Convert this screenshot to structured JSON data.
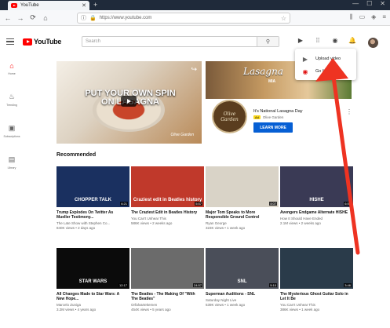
{
  "browser": {
    "tab_title": "YouTube",
    "tab_close": "✕",
    "new_tab": "+",
    "window_controls": [
      "—",
      "☐",
      "✕"
    ],
    "url": "https://www.youtube.com"
  },
  "header": {
    "logo_text": "YouTube",
    "search_placeholder": "Search"
  },
  "sidebar": {
    "items": [
      {
        "label": "Home",
        "icon": "home-icon"
      },
      {
        "label": "Trending",
        "icon": "flame-icon"
      },
      {
        "label": "Subscriptions",
        "icon": "subscriptions-icon"
      },
      {
        "label": "Library",
        "icon": "library-icon"
      }
    ]
  },
  "hero": {
    "caption": "PUT YOUR OWN SPIN ON LASAGNA",
    "brand": "Olive Garden"
  },
  "ad": {
    "banner_word": "Lasagna",
    "banner_sub": "MIA",
    "logo_line1": "Olive",
    "logo_line2": "Garden",
    "title": "It's National Lasagna Day",
    "badge": "Ad",
    "channel": "Olive Garden",
    "button": "LEARN MORE"
  },
  "dropdown": {
    "items": [
      {
        "label": "Upload video",
        "icon": "upload-video-icon"
      },
      {
        "label": "Go live",
        "icon": "go-live-icon"
      }
    ]
  },
  "section_title": "Recommended",
  "videos": [
    {
      "title": "Trump Explodes On Twitter As Mueller Testimony...",
      "channel": "The Late Show with Stephen Co...",
      "stats": "840K views • 2 days ago",
      "duration": "6:21",
      "overlay": "CHOPPER TALK",
      "bg": "#1a3060"
    },
    {
      "title": "The Craziest Edit in Beatles History",
      "channel": "You Can't Unhear This",
      "stats": "586K views • 2 weeks ago",
      "duration": "5:57",
      "overlay": "Craziest edit in Beatles history",
      "bg": "#c0392b"
    },
    {
      "title": "Major Tom Speaks to More Responsible Ground Control",
      "channel": "Ryan George",
      "stats": "323K views • 1 week ago",
      "duration": "4:07",
      "overlay": "",
      "bg": "#d9d3c7"
    },
    {
      "title": "Avengers Endgame Alternate HISHE",
      "channel": "How It Should Have Ended",
      "stats": "2.1M views • 2 weeks ago",
      "duration": "6:52",
      "overlay": "HISHE",
      "bg": "#3a3a55"
    },
    {
      "title": "All Changes Made to Star Wars: A New Hope...",
      "channel": "Marcelo Zuniga",
      "stats": "3.2M views • 4 years ago",
      "duration": "12:17",
      "overlay": "STAR WARS",
      "bg": "#0b0b0b"
    },
    {
      "title": "The Beatles - The Making Of \"With The Beatles\"",
      "channel": "Orfalvartekemen",
      "stats": "454K views • 5 years ago",
      "duration": "24:57",
      "overlay": "",
      "bg": "#6b6b6b"
    },
    {
      "title": "Superman Auditions - SNL",
      "channel": "Saturday Night Live",
      "stats": "539K views • 1 week ago",
      "duration": "5:10",
      "overlay": "SNL",
      "bg": "#4a4e59"
    },
    {
      "title": "The Mysterious Ghost Guitar Solo in Let It Be",
      "channel": "You Can't Unhear This",
      "stats": "386K views • 1 week ago",
      "duration": "3:46",
      "overlay": "",
      "bg": "#2a3b4a"
    }
  ]
}
